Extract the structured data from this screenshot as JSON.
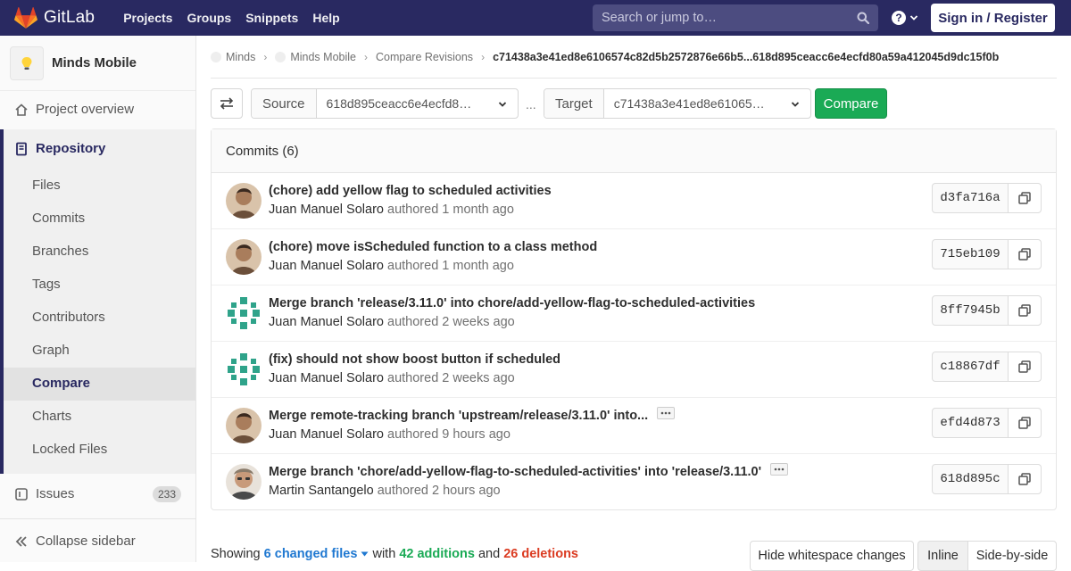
{
  "navbar": {
    "brand": "GitLab",
    "links": [
      "Projects",
      "Groups",
      "Snippets",
      "Help"
    ],
    "search_placeholder": "Search or jump to…",
    "signin_label": "Sign in / Register"
  },
  "sidebar": {
    "project_name": "Minds Mobile",
    "project_overview": "Project overview",
    "repository": "Repository",
    "repo_items": [
      "Files",
      "Commits",
      "Branches",
      "Tags",
      "Contributors",
      "Graph",
      "Compare",
      "Charts",
      "Locked Files"
    ],
    "active_item": "Compare",
    "issues_label": "Issues",
    "issues_count": "233",
    "collapse_label": "Collapse sidebar"
  },
  "breadcrumb": {
    "items": [
      "Minds",
      "Minds Mobile",
      "Compare Revisions"
    ],
    "current": "c71438a3e41ed8e6106574c82d5b2572876e66b5...618d895ceacc6e4ecfd80a59a412045d9dc15f0b"
  },
  "compare_form": {
    "source_label": "Source",
    "source_value": "618d895ceacc6e4ecfd8…",
    "separator": "...",
    "target_label": "Target",
    "target_value": "c71438a3e41ed8e61065…",
    "compare_button": "Compare"
  },
  "commits": {
    "header": "Commits (6)",
    "authored_word": "authored",
    "items": [
      {
        "title": "(chore) add yellow flag to scheduled activities",
        "author": "Juan Manuel Solaro",
        "time": "1 month ago",
        "sha": "d3fa716a",
        "avatar": "photo-juan",
        "more": false
      },
      {
        "title": "(chore) move isScheduled function to a class method",
        "author": "Juan Manuel Solaro",
        "time": "1 month ago",
        "sha": "715eb109",
        "avatar": "photo-juan",
        "more": false
      },
      {
        "title": "Merge branch 'release/3.11.0' into chore/add-yellow-flag-to-scheduled-activities",
        "author": "Juan Manuel Solaro",
        "time": "2 weeks ago",
        "sha": "8ff7945b",
        "avatar": "identicon",
        "more": false
      },
      {
        "title": "(fix) should not show boost button if scheduled",
        "author": "Juan Manuel Solaro",
        "time": "2 weeks ago",
        "sha": "c18867df",
        "avatar": "identicon",
        "more": false
      },
      {
        "title": "Merge remote-tracking branch 'upstream/release/3.11.0' into...",
        "author": "Juan Manuel Solaro",
        "time": "9 hours ago",
        "sha": "efd4d873",
        "avatar": "photo-juan",
        "more": true
      },
      {
        "title": "Merge branch 'chore/add-yellow-flag-to-scheduled-activities' into 'release/3.11.0'",
        "author": "Martin Santangelo",
        "time": "2 hours ago",
        "sha": "618d895c",
        "avatar": "photo-martin",
        "more": true
      }
    ]
  },
  "summary": {
    "showing": "Showing",
    "changed_files": "6 changed files",
    "with": "with",
    "additions": "42 additions",
    "and": "and",
    "deletions": "26 deletions"
  },
  "view_buttons": {
    "hide_whitespace": "Hide whitespace changes",
    "inline": "Inline",
    "side_by_side": "Side-by-side"
  },
  "colors": {
    "navbar": "#292961",
    "compare_button": "#1aaa55",
    "link_blue": "#1f78d1",
    "additions_green": "#1aaa55",
    "deletions_red": "#db3b21"
  }
}
